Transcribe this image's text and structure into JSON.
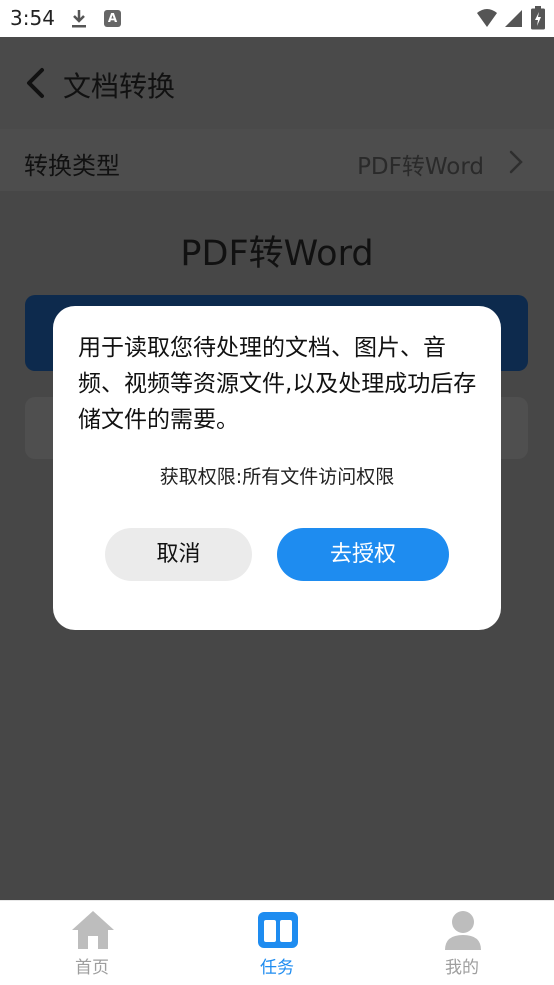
{
  "status_bar": {
    "time": "3:54",
    "download_icon": "download-icon",
    "notification_icon": "a-notification-icon",
    "notification_glyph": "A",
    "wifi_icon": "wifi-icon",
    "signal_icon": "signal-icon",
    "battery_icon": "battery-charging-icon"
  },
  "header": {
    "back_icon": "back-arrow-icon",
    "title": "文档转换"
  },
  "conversion": {
    "label": "转换类型",
    "value": "PDF转Word",
    "chevron_icon": "chevron-right-icon"
  },
  "main_title": "PDF转Word",
  "dialog": {
    "message": "用于读取您待处理的文档、图片、音频、视频等资源文件,以及处理成功后存储文件的需要。",
    "permission": "获取权限:所有文件访问权限",
    "cancel_label": "取消",
    "authorize_label": "去授权"
  },
  "tabs": [
    {
      "label": "首页",
      "icon": "home-icon",
      "active": false
    },
    {
      "label": "任务",
      "icon": "task-icon",
      "active": true
    },
    {
      "label": "我的",
      "icon": "profile-icon",
      "active": false
    }
  ],
  "colors": {
    "accent": "#1e8cf0",
    "overlay": "#474747",
    "tab_inactive": "#bdbdbd",
    "dialog_bg": "#ffffff"
  }
}
